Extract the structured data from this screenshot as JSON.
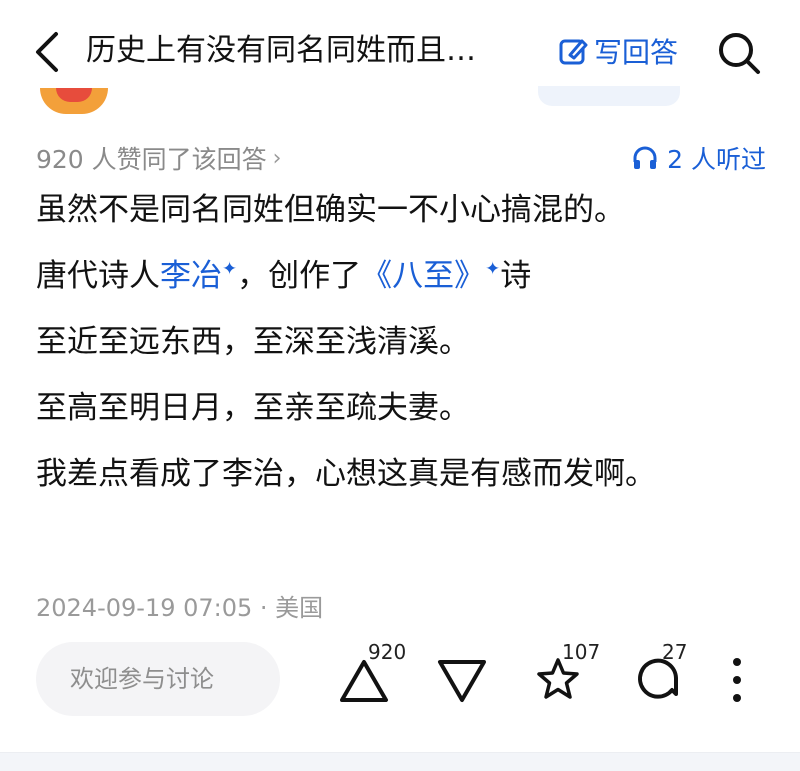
{
  "header": {
    "title": "历史上有没有同名同姓而且…",
    "write_label": "写回答",
    "back_icon": "chevron-left-icon",
    "search_icon": "search-icon"
  },
  "meta": {
    "upvote_text": "920 人赞同了该回答",
    "upvote_chevron": "›",
    "listen_text": "2 人听过"
  },
  "content": {
    "p1": "虽然不是同名同姓但确实一不小心搞混的。",
    "p2_prefix": "唐代诗人",
    "p2_link1": "李冶",
    "p2_mid": "，创作了",
    "p2_link2": "《八至》",
    "p2_suffix": "诗",
    "spark": "✦",
    "p3": "至近至远东西，至深至浅清溪。",
    "p4": "至高至明日月，至亲至疏夫妻。",
    "p5": "我差点看成了李治，心想这真是有感而发啊。"
  },
  "footer": {
    "timestamp": "2024-09-19 07:05 · 美国",
    "comment_placeholder": "欢迎参与讨论",
    "upvote_count": "920",
    "star_count": "107",
    "comment_count": "27"
  },
  "colors": {
    "accent": "#1a5fd6",
    "muted": "#8a8a8a"
  }
}
